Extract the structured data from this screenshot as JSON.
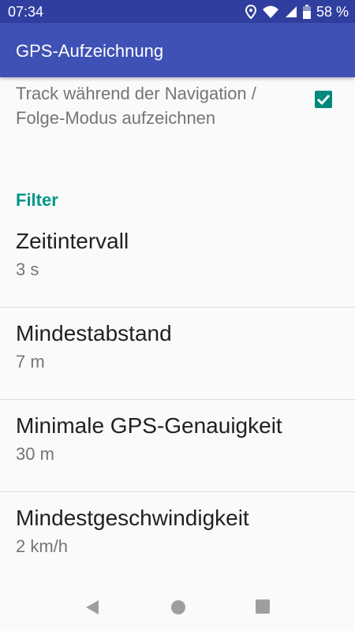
{
  "status_bar": {
    "time": "07:34",
    "battery": "58 %",
    "icons": [
      "location-icon",
      "wifi-icon",
      "signal-icon",
      "battery-icon"
    ]
  },
  "app_bar": {
    "title": "GPS-Aufzeichnung"
  },
  "track_setting": {
    "label": "Track während der Navigation / Folge-Modus aufzeichnen",
    "checked": true
  },
  "category": {
    "title": "Filter"
  },
  "preferences": [
    {
      "title": "Zeitintervall",
      "summary": "3 s"
    },
    {
      "title": "Mindestabstand",
      "summary": "7 m"
    },
    {
      "title": "Minimale GPS-Genauigkeit",
      "summary": "30 m"
    },
    {
      "title": "Mindestgeschwindigkeit",
      "summary": "2 km/h"
    }
  ],
  "nav_bar": {
    "buttons": [
      "back-icon",
      "home-icon",
      "recents-icon"
    ]
  },
  "colors": {
    "status_bar": "#303f9f",
    "app_bar": "#3f51b5",
    "accent": "#009688",
    "checkbox": "#00897b"
  }
}
